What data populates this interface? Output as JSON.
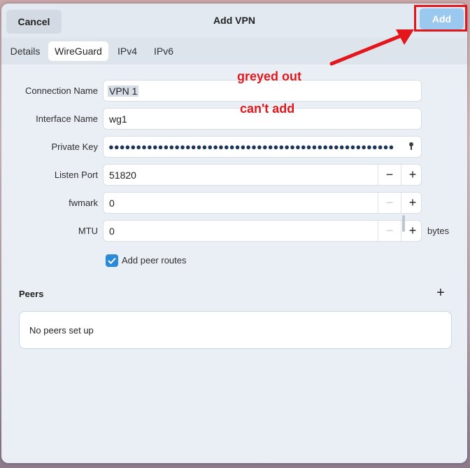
{
  "header": {
    "cancel_label": "Cancel",
    "title": "Add VPN",
    "add_label": "Add"
  },
  "tabs": [
    {
      "label": "Details",
      "active": false
    },
    {
      "label": "WireGuard",
      "active": true
    },
    {
      "label": "IPv4",
      "active": false
    },
    {
      "label": "IPv6",
      "active": false
    }
  ],
  "form": {
    "connection_name": {
      "label": "Connection Name",
      "value": "VPN 1"
    },
    "interface_name": {
      "label": "Interface Name",
      "value": "wg1"
    },
    "private_key": {
      "label": "Private Key",
      "masked": "●●●●●●●●●●●●●●●●●●●●●●●●●●●●●●●●●●●●●●●●●●●●●●●●●●●●"
    },
    "listen_port": {
      "label": "Listen Port",
      "value": "51820",
      "minus": "−",
      "plus": "+"
    },
    "fwmark": {
      "label": "fwmark",
      "value": "0",
      "minus": "−",
      "plus": "+"
    },
    "mtu": {
      "label": "MTU",
      "value": "0",
      "minus": "−",
      "plus": "+",
      "unit": "bytes"
    },
    "add_peer_routes": {
      "label": "Add peer routes",
      "checked": true
    }
  },
  "peers": {
    "title": "Peers",
    "add_icon": "+",
    "empty_text": "No peers set up"
  },
  "annotations": {
    "line1": "greyed out",
    "line2": "can't add"
  },
  "colors": {
    "accent": "#2b8ad8",
    "disabled_button": "#9bc8ef",
    "annotation_red": "#e3161b"
  }
}
